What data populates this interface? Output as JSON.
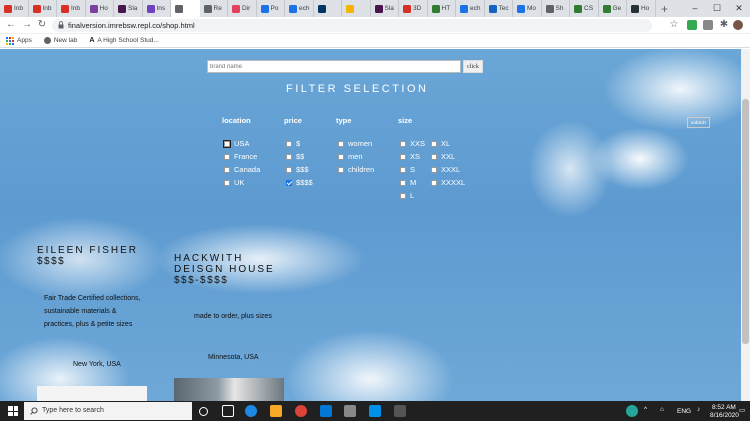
{
  "browser": {
    "tabs": [
      {
        "label": "Inb",
        "color": "#d93025"
      },
      {
        "label": "Inb",
        "color": "#d93025"
      },
      {
        "label": "Inb",
        "color": "#d93025"
      },
      {
        "label": "Ho",
        "color": "#7b3fa0"
      },
      {
        "label": "Sla",
        "color": "#4a154b"
      },
      {
        "label": "Ins",
        "color": "#6f42c1"
      },
      {
        "label": "",
        "color": "#5f6368"
      },
      {
        "label": "Re",
        "color": "#5f6368"
      },
      {
        "label": "Dir",
        "color": "#e4405f"
      },
      {
        "label": "Po",
        "color": "#1a73e8"
      },
      {
        "label": "ech",
        "color": "#1a73e8"
      },
      {
        "label": "",
        "color": "#003366"
      },
      {
        "label": "",
        "color": "#f4b400"
      },
      {
        "label": "Sla",
        "color": "#4a154b"
      },
      {
        "label": "3D",
        "color": "#d93025"
      },
      {
        "label": "HT",
        "color": "#2e7d32"
      },
      {
        "label": "ech",
        "color": "#1a73e8"
      },
      {
        "label": "Tec",
        "color": "#1565c0"
      },
      {
        "label": "Mo",
        "color": "#1a73e8"
      },
      {
        "label": "Sh",
        "color": "#5f6368"
      },
      {
        "label": "CS",
        "color": "#2e7d32"
      },
      {
        "label": "Ge",
        "color": "#2e7d32"
      },
      {
        "label": "Ho",
        "color": "#263238"
      }
    ],
    "active_tab_index": 6,
    "new_tab_label": "+",
    "url": "finalversion.imrebsw.repl.co/shop.html",
    "bookmarks": [
      {
        "label": "Apps"
      },
      {
        "label": "New lab"
      },
      {
        "label": "A High School Stud..."
      }
    ]
  },
  "page": {
    "brand_input_placeholder": "brand name",
    "click_label": "click",
    "filter_title": "FILTER SELECTION",
    "submit_label": "submit",
    "columns": {
      "location": {
        "heading": "location",
        "options": [
          "USA",
          "France",
          "Canada",
          "UK"
        ]
      },
      "price": {
        "heading": "price",
        "options": [
          "$",
          "$$",
          "$$$",
          "$$$$"
        ],
        "checked_index": 3
      },
      "type": {
        "heading": "type",
        "options": [
          "women",
          "men",
          "children"
        ]
      },
      "size": {
        "heading": "size",
        "options_left": [
          "XXS",
          "XS",
          "S",
          "M",
          "L"
        ],
        "options_right": [
          "XL",
          "XXL",
          "XXXL",
          "XXXXL"
        ]
      }
    },
    "stores": [
      {
        "name": "EILEEN FISHER",
        "price": "$$$$",
        "description": [
          "Fair Trade Certified collections,",
          "sustainable materials &",
          "practices, plus & petite sizes"
        ],
        "location": "New York, USA"
      },
      {
        "name_line1": "HACKWITH",
        "name_line2": "DEISGN HOUSE",
        "price": "$$$-$$$$",
        "description": [
          "made to order, plus sizes"
        ],
        "location": "Minnesota, USA"
      }
    ]
  },
  "taskbar": {
    "search_placeholder": "Type here to search",
    "language": "ENG",
    "time": "8:52 AM",
    "date": "8/16/2020"
  }
}
